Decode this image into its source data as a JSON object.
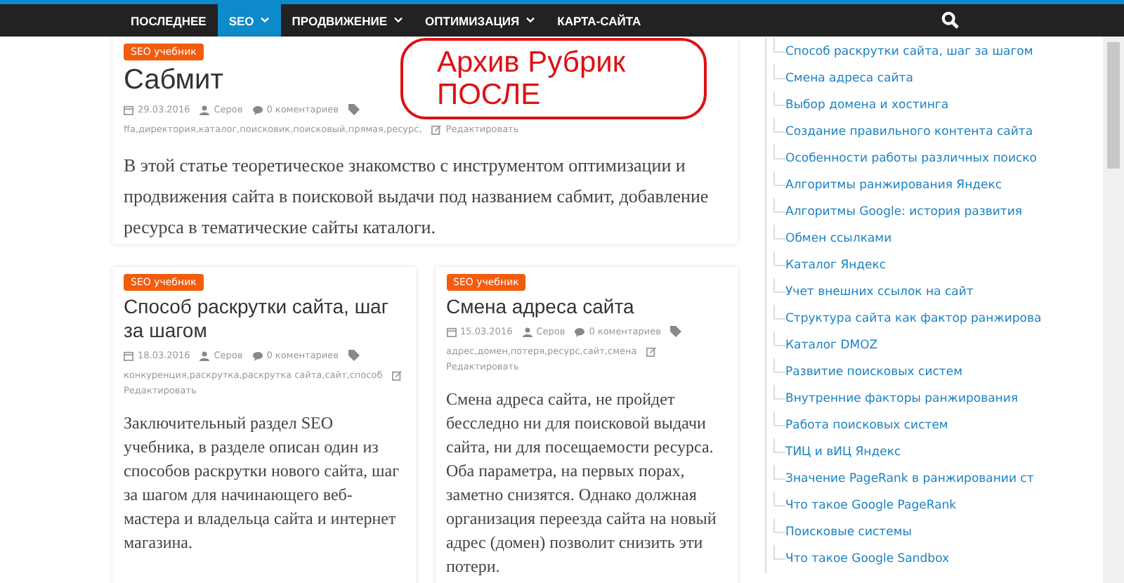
{
  "nav": {
    "items": [
      {
        "label": "ПОСЛЕДНЕЕ",
        "selected": false,
        "dropdown": false
      },
      {
        "label": "SEO",
        "selected": true,
        "dropdown": true
      },
      {
        "label": "ПРОДВИЖЕНИЕ",
        "selected": false,
        "dropdown": true
      },
      {
        "label": "ОПТИМИЗАЦИЯ",
        "selected": false,
        "dropdown": true
      },
      {
        "label": "КАРТА-САЙТА",
        "selected": false,
        "dropdown": false
      }
    ]
  },
  "annotation": {
    "lines": [
      "Архив Рубрик",
      "ПОСЛЕ"
    ]
  },
  "featured_post": {
    "category": "SEO учебник",
    "title": "Сабмит",
    "date": "29.03.2016",
    "author": "Серов",
    "comments": "0 коментариев",
    "tags": "ffa,директория,каталог,поисковик,поисковый,прямая,ресурс,",
    "edit": "Редактировать",
    "excerpt": "В этой статье теоретическое знакомство с инструментом оптимизации и продвижения сайта в поисковой выдачи под названием сабмит, добавление ресурса в тематические сайты каталоги."
  },
  "posts": [
    {
      "category": "SEO учебник",
      "title": "Способ раскрутки сайта, шаг за шагом",
      "date": "18.03.2016",
      "author": "Серов",
      "comments": "0 коментариев",
      "tags": "конкуренция,раскрутка,раскрутка сайта,сайт,способ",
      "edit": "Редактировать",
      "excerpt": "Заключительный раздел SEO учебника, в разделе описан один из способов раскрутки нового сайта, шаг за шагом для начинающего веб-мастера и владельца сайта и интернет магазина."
    },
    {
      "category": "SEO учебник",
      "title": "Смена адреса сайта",
      "date": "15.03.2016",
      "author": "Серов",
      "comments": "0 коментариев",
      "tags": "адрес,домен,потеря,ресурс,сайт,смена",
      "edit": "Редактировать",
      "excerpt": "Смена адреса сайта, не пройдет бесследно ни для поисковой выдачи сайта, ни для посещаемости ресурса. Оба параметра, на первых порах, заметно снизятся. Однако должная организация переезда сайта на новый адрес (домен) позволит снизить эти потери."
    }
  ],
  "sidebar": {
    "items": [
      "Способ раскрутки сайта, шаг за шагом",
      "Смена адреса сайта",
      "Выбор домена и хостинга",
      "Создание правильного контента сайта",
      "Особенности работы различных поиско",
      "Алгоритмы ранжирования Яндекс",
      "Алгоритмы Google: история развития",
      "Обмен ссылками",
      "Каталог Яндекс",
      "Учет внешних ссылок на сайт",
      "Структура сайта как фактор ранжирова",
      "Каталог DMOZ",
      "Развитие поисковых систем",
      "Внутренние факторы ранжирования",
      "Работа поисковых систем",
      "ТИЦ и вИЦ Яндекс",
      "Значение PageRank в ранжировании ст",
      "Что такое Google PageRank",
      "Поисковые системы",
      "Что такое Google Sandbox"
    ]
  }
}
